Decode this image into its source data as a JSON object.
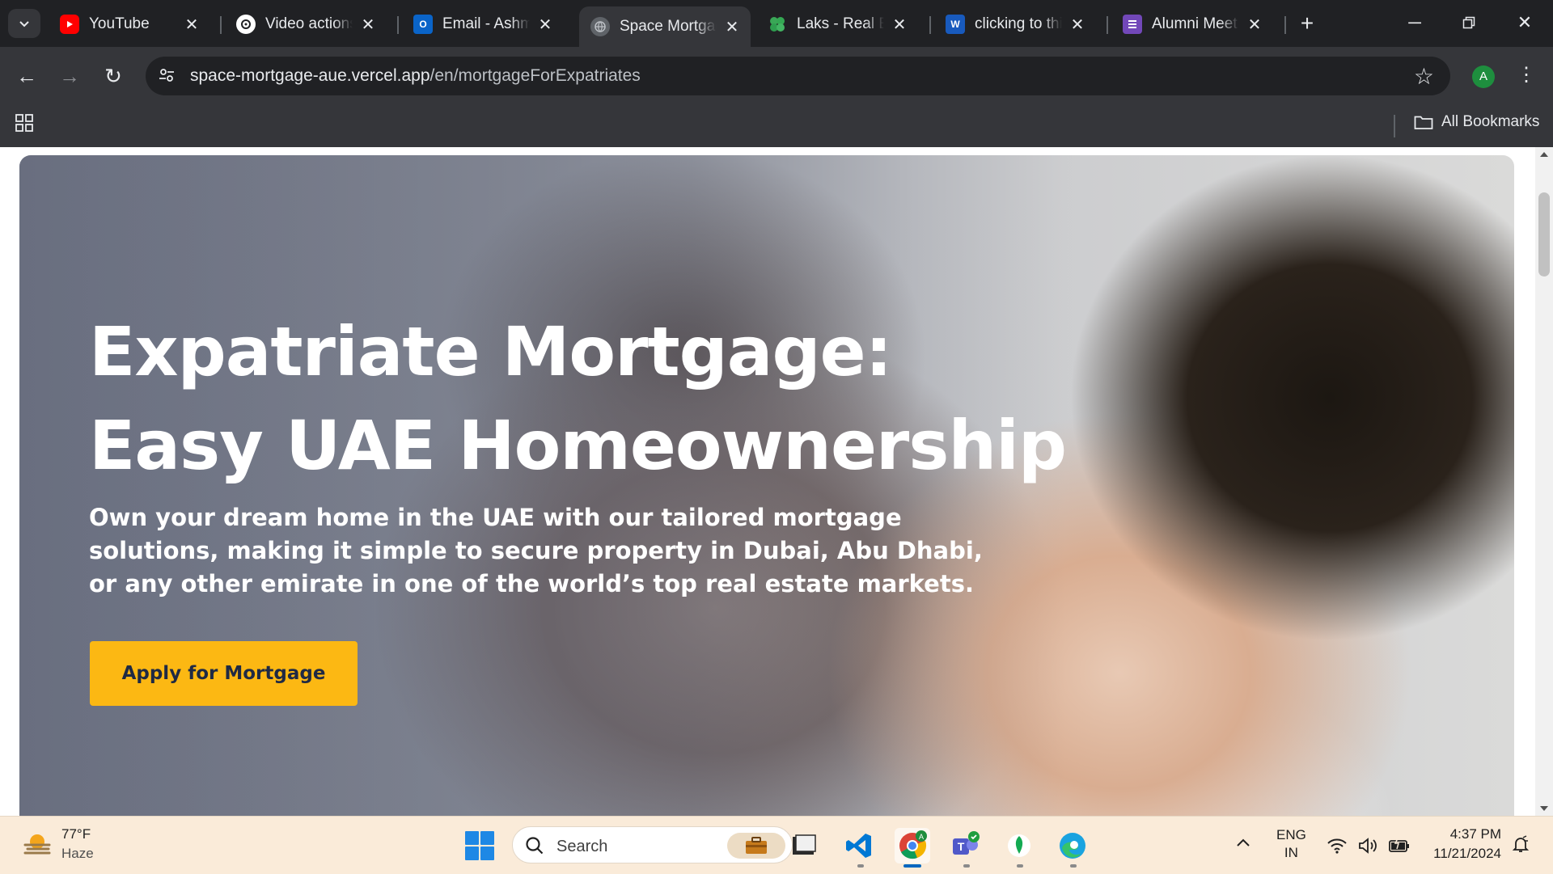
{
  "browser": {
    "tabs": [
      {
        "title": "YouTube",
        "icon": "youtube-icon",
        "color": "#ff0000",
        "active": false
      },
      {
        "title": "Video actions",
        "icon": "openai-icon",
        "color": "#ffffff",
        "active": false
      },
      {
        "title": "Email - Ashmit",
        "icon": "outlook-icon",
        "color": "#0a64c8",
        "active": false
      },
      {
        "title": "Space Mortgage",
        "icon": "globe-icon",
        "color": "#8a8c90",
        "active": true
      },
      {
        "title": "Laks - Real Estate",
        "icon": "leaf-icon",
        "color": "#3aa757",
        "active": false
      },
      {
        "title": "clicking to this",
        "icon": "word-icon",
        "color": "#185abd",
        "active": false
      },
      {
        "title": "Alumni Meet",
        "icon": "forms-icon",
        "color": "#7248b9",
        "active": false
      }
    ],
    "address": {
      "domain": "space-mortgage-aue.vercel.app",
      "path": "/en/mortgageForExpatriates"
    },
    "profile_initial": "A",
    "bookmarks_label": "All Bookmarks"
  },
  "hero": {
    "heading": "Expatriate Mortgage: Easy UAE Homeownership",
    "subtext": "Own your dream home in the UAE with our tailored mortgage solutions, making it simple to secure property in Dubai, Abu Dhabi, or any other emirate in one of the world’s top real estate markets.",
    "cta_label": "Apply for Mortgage",
    "cta_color": "#fcb813"
  },
  "taskbar": {
    "weather": {
      "temp": "77°F",
      "condition": "Haze"
    },
    "search_placeholder": "Search",
    "pinned_apps": [
      "file-explorer-icon",
      "vscode-icon",
      "chrome-icon",
      "teams-icon",
      "mongodb-compass-icon",
      "edge-icon"
    ],
    "language": {
      "line1": "ENG",
      "line2": "IN"
    },
    "time": "4:37 PM",
    "date": "11/21/2024"
  }
}
